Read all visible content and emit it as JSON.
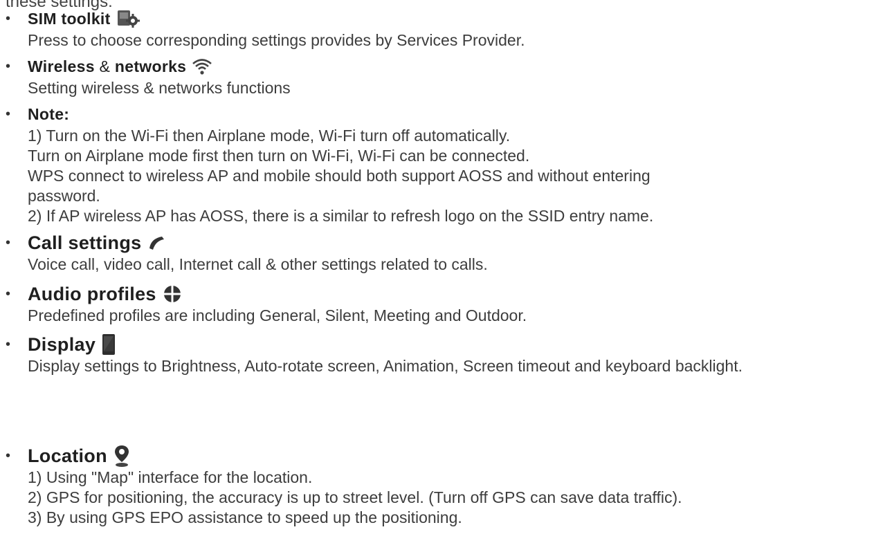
{
  "page_top_fragment": "these settings:",
  "sections": {
    "sim": {
      "title": "SIM toolkit",
      "icon": "sim-toolkit-gear-icon",
      "desc": "Press to choose corresponding settings provides by Services Provider."
    },
    "wireless": {
      "title_a": "Wireless",
      "title_amp": "&",
      "title_b": "networks",
      "icon": "wifi-icon",
      "desc": "Setting wireless & networks functions"
    },
    "note": {
      "title": "Note:",
      "lines": [
        "1) Turn on the Wi-Fi then Airplane mode, Wi-Fi turn off automatically.",
        "Turn on Airplane mode first then turn on Wi-Fi, Wi-Fi can be connected.",
        "WPS connect to wireless AP and mobile should both support AOSS and without entering",
        "password.",
        "2) If AP wireless AP has AOSS, there is a similar to refresh logo on the SSID entry name."
      ]
    },
    "call": {
      "title": "Call settings",
      "icon": "phone-handset-icon",
      "desc": "Voice call, video call, Internet call & other settings related to calls."
    },
    "audio": {
      "title": "Audio profiles",
      "icon": "audio-profiles-icon",
      "desc": "Predefined profiles are including General, Silent, Meeting and Outdoor."
    },
    "display": {
      "title": "Display",
      "icon": "display-phone-icon",
      "desc": "Display settings to Brightness, Auto-rotate screen, Animation, Screen timeout and keyboard backlight."
    },
    "location": {
      "title": "Location",
      "icon": "location-pin-icon",
      "lines": [
        "1) Using \"Map\" interface for the location.",
        "2) GPS for positioning, the accuracy is up to street level. (Turn off GPS can save data traffic).",
        "3) By using GPS EPO assistance to speed up the positioning."
      ]
    }
  },
  "colors": {
    "text": "#3d3d3d",
    "heading": "#1f1f1f",
    "icon": "#4a4a4a"
  }
}
